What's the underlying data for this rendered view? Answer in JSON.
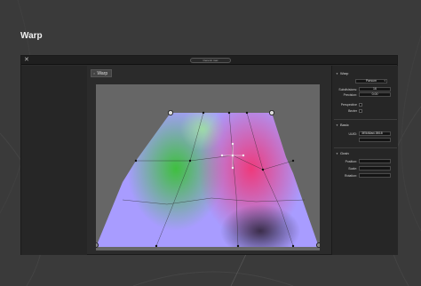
{
  "page": {
    "title": "Warp"
  },
  "window": {
    "close_glyph": "✕",
    "url": "Oeneric.mac"
  },
  "tab": {
    "label": "Warp",
    "close_glyph": "×"
  },
  "right_panel": {
    "warp_section": {
      "label": "Warp",
      "mode": "Parsum",
      "subdivisions_label": "Subdivisions:",
      "subdivisions_value": "16",
      "precision_label": "Precision:",
      "precision_value": "0.00",
      "perspective_label": "Perspective",
      "bezier_label": "Bezier"
    },
    "basic_section": {
      "label": "Basic",
      "uuid_label": "UUID:",
      "uuid_value": "3E5A8ad-3B18"
    },
    "grain_section": {
      "label": "Grain",
      "position_label": "Position:",
      "scale_label": "Scale:",
      "rotation_label": "Rotation:"
    }
  },
  "colors": {
    "green": "#3fbf3f",
    "pink": "#e83a7a",
    "lavender": "#a8a0ff",
    "dark_purple": "#3a2a46"
  },
  "icons": {
    "close": "close-icon",
    "section_toggle": "triangle-down-icon",
    "crosshair": "crosshair-icon"
  }
}
